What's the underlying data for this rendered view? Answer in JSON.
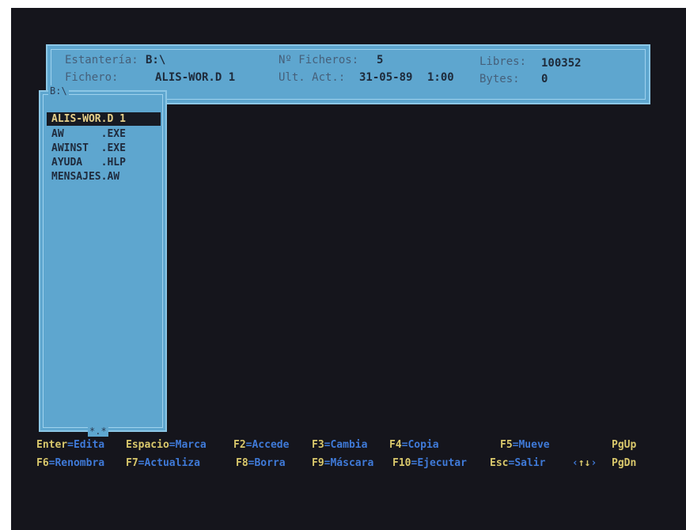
{
  "header": {
    "shelf_label": "Estantería:",
    "shelf_value": "B:\\",
    "file_label": "Fichero:",
    "file_value": "ALIS-WOR.D 1",
    "count_label": "Nº Ficheros:",
    "count_value": "5",
    "lastact_label": "Ult. Act.:",
    "lastact_date": "31-05-89",
    "lastact_time": "1:00",
    "free_label": "Libres:",
    "free_value": "100352",
    "bytes_label": "Bytes:",
    "bytes_value": "0"
  },
  "panel": {
    "path": "B:\\",
    "mask": "*.*",
    "files": [
      "ALIS-WOR.D 1",
      "AW      .EXE",
      "AWINST  .EXE",
      "AYUDA   .HLP",
      "MENSAJES.AW"
    ]
  },
  "fkeys": {
    "row1": [
      {
        "key": "Enter",
        "action": "Edita"
      },
      {
        "key": "Espacio",
        "action": "Marca"
      },
      {
        "key": "F2",
        "action": "Accede"
      },
      {
        "key": "F3",
        "action": "Cambia"
      },
      {
        "key": "F4",
        "action": "Copia"
      },
      {
        "key": "F5",
        "action": "Mueve"
      }
    ],
    "row1_end": "PgUp",
    "row2": [
      {
        "key": "F6",
        "action": "Renombra"
      },
      {
        "key": "F7",
        "action": "Actualiza"
      },
      {
        "key": "F8",
        "action": "Borra"
      },
      {
        "key": "F9",
        "action": "Máscara"
      },
      {
        "key": "F10",
        "action": "Ejecutar"
      },
      {
        "key": "Esc",
        "action": "Salir"
      }
    ],
    "arrows": "↑↓",
    "row2_end": "PgDn"
  },
  "colors": {
    "screen_bg": "#15151c",
    "window_bg": "#5ea6cf",
    "key_text": "#d9c86c",
    "action_text": "#3f7ad8",
    "selection_bg": "#171a23"
  }
}
